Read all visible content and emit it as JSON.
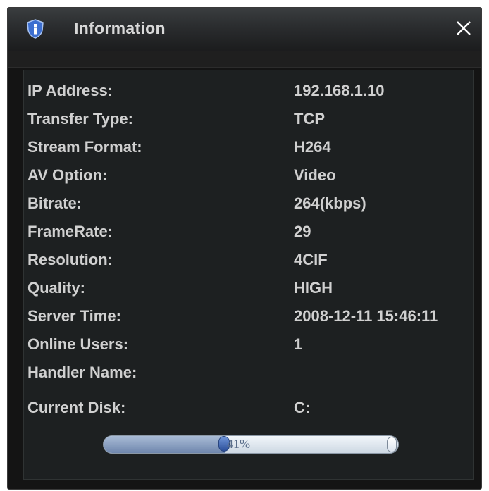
{
  "dialog": {
    "title": "Information",
    "title_icon": "info-shield-icon",
    "close_icon": "close-icon"
  },
  "info": {
    "rows": [
      {
        "label": "IP Address:",
        "value": "192.168.1.10"
      },
      {
        "label": "Transfer Type:",
        "value": "TCP"
      },
      {
        "label": "Stream Format:",
        "value": "H264"
      },
      {
        "label": "AV Option:",
        "value": "Video"
      },
      {
        "label": "Bitrate:",
        "value": "264(kbps)"
      },
      {
        "label": "FrameRate:",
        "value": "29"
      },
      {
        "label": "Resolution:",
        "value": "4CIF"
      },
      {
        "label": "Quality:",
        "value": "HIGH"
      },
      {
        "label": "Server Time:",
        "value": "2008-12-11 15:46:11"
      },
      {
        "label": "Online Users:",
        "value": "1"
      },
      {
        "label": "Handler Name:",
        "value": ""
      },
      {
        "label": "Current Disk:",
        "value": "C:"
      }
    ]
  },
  "disk_usage": {
    "percent": 41,
    "label": "41%"
  },
  "colors": {
    "background": "#141414",
    "panel": "#1d2021",
    "text": "#d0d0d0",
    "progress_fill": "#6f86ad",
    "progress_knob": "#2c4f9a"
  }
}
